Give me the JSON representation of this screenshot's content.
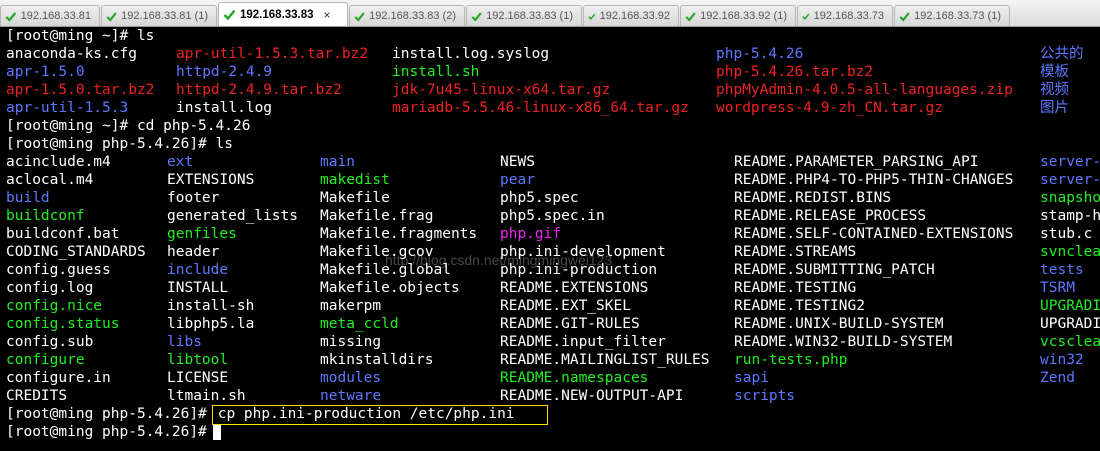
{
  "tabs": [
    {
      "label": "192.168.33.81",
      "active": false
    },
    {
      "label": "192.168.33.81 (1)",
      "active": false
    },
    {
      "label": "192.168.33.83",
      "active": true
    },
    {
      "label": "192.168.33.83 (2)",
      "active": false
    },
    {
      "label": "192.168.33.83 (1)",
      "active": false
    },
    {
      "label": "192.168.33.92",
      "active": false
    },
    {
      "label": "192.168.33.92 (1)",
      "active": false
    },
    {
      "label": "192.168.33.73",
      "active": false
    },
    {
      "label": "192.168.33.73 (1)",
      "active": false
    }
  ],
  "tab_close_glyph": "×",
  "colors": {
    "white": "#ffffff",
    "blue": "#5f77ff",
    "green": "#22ee22",
    "red": "#ee2222",
    "cyan": "#22dddd",
    "highlight": "#ffe000"
  },
  "terminal": {
    "lines": [
      {
        "kind": "prompt",
        "text": "[root@ming ~]# ls"
      },
      {
        "kind": "row",
        "cells": [
          {
            "text": "anaconda-ks.cfg",
            "color": "white"
          },
          {
            "text": "apr-util-1.5.3.tar.bz2",
            "color": "red"
          },
          {
            "text": "install.log.syslog",
            "color": "white"
          },
          {
            "text": "php-5.4.26",
            "color": "blue"
          },
          {
            "text": "公共的",
            "color": "blue"
          }
        ]
      },
      {
        "kind": "row",
        "cells": [
          {
            "text": "apr-1.5.0",
            "color": "blue"
          },
          {
            "text": "httpd-2.4.9",
            "color": "blue"
          },
          {
            "text": "install.sh",
            "color": "green"
          },
          {
            "text": "php-5.4.26.tar.bz2",
            "color": "red"
          },
          {
            "text": "模板",
            "color": "blue"
          }
        ]
      },
      {
        "kind": "row",
        "cells": [
          {
            "text": "apr-1.5.0.tar.bz2",
            "color": "red"
          },
          {
            "text": "httpd-2.4.9.tar.bz2",
            "color": "red"
          },
          {
            "text": "jdk-7u45-linux-x64.tar.gz",
            "color": "red"
          },
          {
            "text": "phpMyAdmin-4.0.5-all-languages.zip",
            "color": "red"
          },
          {
            "text": "视频",
            "color": "blue"
          }
        ]
      },
      {
        "kind": "row",
        "cells": [
          {
            "text": "apr-util-1.5.3",
            "color": "blue"
          },
          {
            "text": "install.log",
            "color": "white"
          },
          {
            "text": "mariadb-5.5.46-linux-x86_64.tar.gz",
            "color": "red"
          },
          {
            "text": "wordpress-4.9-zh_CN.tar.gz",
            "color": "red"
          },
          {
            "text": "图片",
            "color": "blue"
          }
        ]
      },
      {
        "kind": "prompt",
        "text": "[root@ming ~]# cd php-5.4.26"
      },
      {
        "kind": "prompt",
        "text": "[root@ming php-5.4.26]# ls"
      },
      {
        "kind": "row",
        "cells": [
          {
            "text": "acinclude.m4",
            "color": "white"
          },
          {
            "text": "ext",
            "color": "blue"
          },
          {
            "text": "main",
            "color": "blue"
          },
          {
            "text": "NEWS",
            "color": "white"
          },
          {
            "text": "README.PARAMETER_PARSING_API",
            "color": "white"
          },
          {
            "text": "server-",
            "color": "blue"
          }
        ]
      },
      {
        "kind": "row",
        "cells": [
          {
            "text": "aclocal.m4",
            "color": "white"
          },
          {
            "text": "EXTENSIONS",
            "color": "white"
          },
          {
            "text": "makedist",
            "color": "green"
          },
          {
            "text": "pear",
            "color": "blue"
          },
          {
            "text": "README.PHP4-TO-PHP5-THIN-CHANGES",
            "color": "white"
          },
          {
            "text": "server-",
            "color": "blue"
          }
        ]
      },
      {
        "kind": "row",
        "cells": [
          {
            "text": "build",
            "color": "blue"
          },
          {
            "text": "footer",
            "color": "white"
          },
          {
            "text": "Makefile",
            "color": "white"
          },
          {
            "text": "php5.spec",
            "color": "white"
          },
          {
            "text": "README.REDIST.BINS",
            "color": "white"
          },
          {
            "text": "snapsho",
            "color": "green"
          }
        ]
      },
      {
        "kind": "row",
        "cells": [
          {
            "text": "buildconf",
            "color": "green"
          },
          {
            "text": "generated_lists",
            "color": "white"
          },
          {
            "text": "Makefile.frag",
            "color": "white"
          },
          {
            "text": "php5.spec.in",
            "color": "white"
          },
          {
            "text": "README.RELEASE_PROCESS",
            "color": "white"
          },
          {
            "text": "stamp-h",
            "color": "white"
          }
        ]
      },
      {
        "kind": "row",
        "cells": [
          {
            "text": "buildconf.bat",
            "color": "white"
          },
          {
            "text": "genfiles",
            "color": "green"
          },
          {
            "text": "Makefile.fragments",
            "color": "white"
          },
          {
            "text": "php.gif",
            "color": "magenta"
          },
          {
            "text": "README.SELF-CONTAINED-EXTENSIONS",
            "color": "white"
          },
          {
            "text": "stub.c",
            "color": "white"
          }
        ]
      },
      {
        "kind": "row",
        "cells": [
          {
            "text": "CODING_STANDARDS",
            "color": "white"
          },
          {
            "text": "header",
            "color": "white"
          },
          {
            "text": "Makefile.gcov",
            "color": "white"
          },
          {
            "text": "php.ini-development",
            "color": "white"
          },
          {
            "text": "README.STREAMS",
            "color": "white"
          },
          {
            "text": "svnclea",
            "color": "green"
          }
        ]
      },
      {
        "kind": "row",
        "cells": [
          {
            "text": "config.guess",
            "color": "white"
          },
          {
            "text": "include",
            "color": "blue"
          },
          {
            "text": "Makefile.global",
            "color": "white"
          },
          {
            "text": "php.ini-production",
            "color": "white"
          },
          {
            "text": "README.SUBMITTING_PATCH",
            "color": "white"
          },
          {
            "text": "tests",
            "color": "blue"
          }
        ]
      },
      {
        "kind": "row",
        "cells": [
          {
            "text": "config.log",
            "color": "white"
          },
          {
            "text": "INSTALL",
            "color": "white"
          },
          {
            "text": "Makefile.objects",
            "color": "white"
          },
          {
            "text": "README.EXTENSIONS",
            "color": "white"
          },
          {
            "text": "README.TESTING",
            "color": "white"
          },
          {
            "text": "TSRM",
            "color": "blue"
          }
        ]
      },
      {
        "kind": "row",
        "cells": [
          {
            "text": "config.nice",
            "color": "green"
          },
          {
            "text": "install-sh",
            "color": "white"
          },
          {
            "text": "makerpm",
            "color": "white"
          },
          {
            "text": "README.EXT_SKEL",
            "color": "white"
          },
          {
            "text": "README.TESTING2",
            "color": "white"
          },
          {
            "text": "UPGRADI",
            "color": "green"
          }
        ]
      },
      {
        "kind": "row",
        "cells": [
          {
            "text": "config.status",
            "color": "green"
          },
          {
            "text": "libphp5.la",
            "color": "white"
          },
          {
            "text": "meta_ccld",
            "color": "green"
          },
          {
            "text": "README.GIT-RULES",
            "color": "white"
          },
          {
            "text": "README.UNIX-BUILD-SYSTEM",
            "color": "white"
          },
          {
            "text": "UPGRADI",
            "color": "white"
          }
        ]
      },
      {
        "kind": "row",
        "cells": [
          {
            "text": "config.sub",
            "color": "white"
          },
          {
            "text": "libs",
            "color": "blue"
          },
          {
            "text": "missing",
            "color": "white"
          },
          {
            "text": "README.input_filter",
            "color": "white"
          },
          {
            "text": "README.WIN32-BUILD-SYSTEM",
            "color": "white"
          },
          {
            "text": "vcsclea",
            "color": "green"
          }
        ]
      },
      {
        "kind": "row",
        "cells": [
          {
            "text": "configure",
            "color": "green"
          },
          {
            "text": "libtool",
            "color": "green"
          },
          {
            "text": "mkinstalldirs",
            "color": "white"
          },
          {
            "text": "README.MAILINGLIST_RULES",
            "color": "white"
          },
          {
            "text": "run-tests.php",
            "color": "green"
          },
          {
            "text": "win32",
            "color": "blue"
          }
        ]
      },
      {
        "kind": "row",
        "cells": [
          {
            "text": "configure.in",
            "color": "white"
          },
          {
            "text": "LICENSE",
            "color": "white"
          },
          {
            "text": "modules",
            "color": "blue"
          },
          {
            "text": "README.namespaces",
            "color": "green"
          },
          {
            "text": "sapi",
            "color": "blue"
          },
          {
            "text": "Zend",
            "color": "blue"
          }
        ]
      },
      {
        "kind": "row",
        "cells": [
          {
            "text": "CREDITS",
            "color": "white"
          },
          {
            "text": "ltmain.sh",
            "color": "white"
          },
          {
            "text": "netware",
            "color": "blue"
          },
          {
            "text": "README.NEW-OUTPUT-API",
            "color": "white"
          },
          {
            "text": "scripts",
            "color": "blue"
          },
          {
            "text": "",
            "color": "white"
          }
        ]
      },
      {
        "kind": "prompt_cmd",
        "prompt": "[root@ming php-5.4.26]#",
        "cmd": " cp php.ini-production /etc/php.ini"
      },
      {
        "kind": "prompt_cursor",
        "prompt": "[root@ming php-5.4.26]#"
      }
    ]
  },
  "watermark": "http://blog.csdn.net/mingmingwei123"
}
